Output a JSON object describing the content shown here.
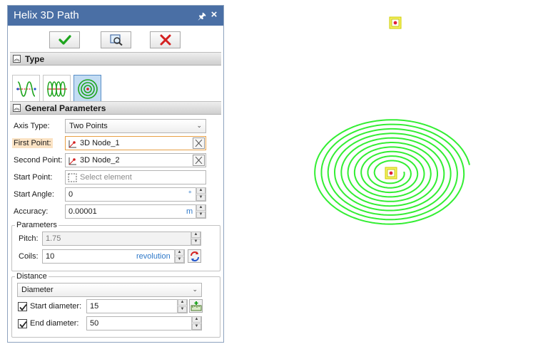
{
  "window": {
    "title": "Helix 3D Path",
    "pin_glyph": "🖈",
    "close_glyph": "×"
  },
  "toolbar": {
    "ok_icon": "check-icon",
    "preview_icon": "preview-icon",
    "cancel_icon": "cancel-x-icon"
  },
  "sections": {
    "type": "Type",
    "general": "General Parameters"
  },
  "type_options": [
    {
      "icon": "helix-axis-icon",
      "selected": false
    },
    {
      "icon": "helix-coil-icon",
      "selected": false
    },
    {
      "icon": "spiral-icon",
      "selected": true
    }
  ],
  "fields": {
    "axis_type": {
      "label": "Axis Type:",
      "value": "Two Points"
    },
    "first_point": {
      "label": "First Point:",
      "value": "3D Node_1"
    },
    "second_point": {
      "label": "Second Point:",
      "value": "3D Node_2"
    },
    "start_point": {
      "label": "Start Point:",
      "placeholder": "Select element"
    },
    "start_angle": {
      "label": "Start Angle:",
      "value": "0",
      "unit": "°"
    },
    "accuracy": {
      "label": "Accuracy:",
      "value": "0.00001",
      "unit": "m"
    }
  },
  "parameters": {
    "title": "Parameters",
    "pitch": {
      "label": "Pitch:",
      "value": "1.75"
    },
    "coils": {
      "label": "Coils:",
      "value": "10",
      "unit": "revolution"
    }
  },
  "distance": {
    "title": "Distance",
    "mode": "Diameter",
    "start_diameter": {
      "label": "Start diameter:",
      "value": "15",
      "checked": true
    },
    "end_diameter": {
      "label": "End diameter:",
      "value": "50",
      "checked": true
    }
  },
  "colors": {
    "title_bar": "#4a6fa5",
    "spiral": "#33ee33",
    "node_marker_fill": "#f5f060",
    "node_marker_dot": "#e0203a",
    "ok_green": "#1ea51e",
    "cancel_red": "#d42020",
    "focus_orange": "#e8a046"
  }
}
